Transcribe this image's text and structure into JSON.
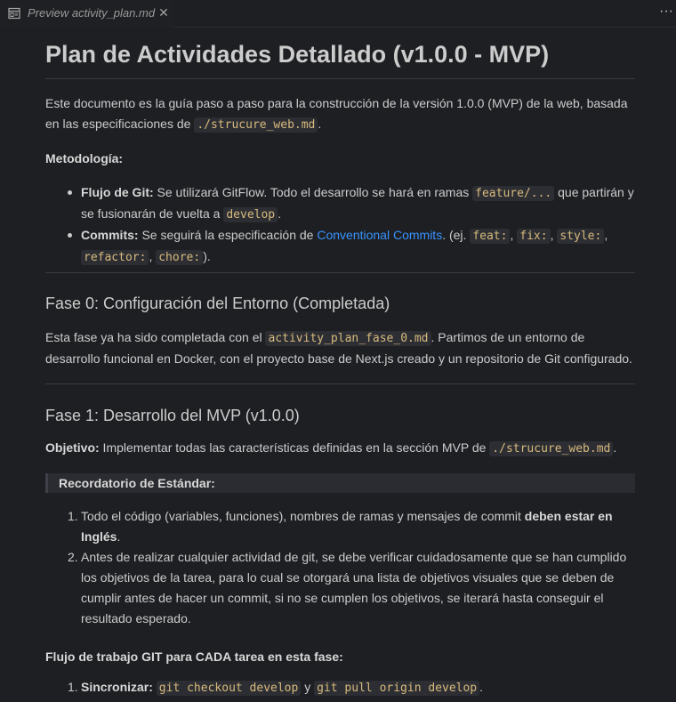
{
  "tab": {
    "label": "Preview activity_plan.md",
    "close_glyph": "✕",
    "icon": "preview-icon"
  },
  "more_actions_glyph": "···",
  "doc": {
    "title": "Plan de Actividades Detallado (v1.0.0 - MVP)",
    "intro": {
      "text": "Este documento es la guía paso a paso para la construcción de la versión 1.0.0 (MVP) de la web, basada en las especificaciones de ",
      "code": "./strucure_web.md",
      "end": "."
    },
    "methodology_label": "Metodología:",
    "methodology": [
      {
        "label": "Flujo de Git:",
        "text1": " Se utilizará GitFlow. Todo el desarrollo se hará en ramas ",
        "code1": "feature/...",
        "text2": " que partirán y se fusionarán de vuelta a ",
        "code2": "develop",
        "end": "."
      },
      {
        "label": "Commits:",
        "text1": " Se seguirá la especificación de ",
        "link": "Conventional Commits",
        "text2": ". (ej. ",
        "codes": [
          "feat:",
          "fix:",
          "style:",
          "refactor:",
          "chore:"
        ],
        "end": ")."
      }
    ],
    "phase0": {
      "title": "Fase 0: Configuración del Entorno (Completada)",
      "text1": "Esta fase ya ha sido completada con el ",
      "code": "activity_plan_fase_0.md",
      "text2": ". Partimos de un entorno de desarrollo funcional en Docker, con el proyecto base de Next.js creado y un repositorio de Git configurado."
    },
    "phase1": {
      "title": "Fase 1: Desarrollo del MVP (v1.0.0)",
      "objective_label": "Objetivo:",
      "objective_text": " Implementar todas las características definidas en la sección MVP de ",
      "objective_code": "./strucure_web.md",
      "objective_end": ".",
      "reminder_title": "Recordatorio de Estándar:",
      "reminders": [
        {
          "num": "1.",
          "text": "Todo el código (variables, funciones), nombres de ramas y mensajes de commit ",
          "bold": "deben estar en Inglés",
          "end": "."
        },
        {
          "num": "2.",
          "text": "Antes de realizar cualquier actividad de git, se debe verificar cuidadosamente que se han cumplido los objetivos de la tarea, para lo cual se otorgará una lista de objetivos visuales que se deben de cumplir antes de hacer un commit, si no se cumplen los objetivos, se iterará hasta conseguir el resultado esperado."
        }
      ],
      "workflow_title": "Flujo de trabajo GIT para CADA tarea en esta fase:",
      "workflow": [
        {
          "num": "1.",
          "label": "Sincronizar:",
          "code1": "git checkout develop",
          "mid": " y ",
          "code2": "git pull origin develop",
          "end": "."
        }
      ]
    }
  },
  "colors": {
    "background": "#1e1f22",
    "text": "#cccccc",
    "code": "#d7ba7d",
    "link": "#3794ff"
  }
}
